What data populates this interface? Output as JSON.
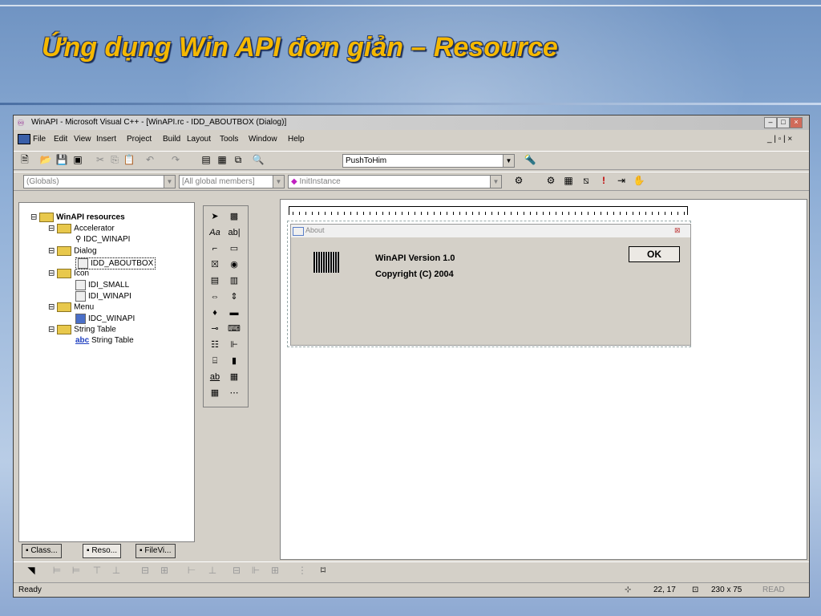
{
  "slide": {
    "title": "Ứng dụng Win API đơn giản – Resource"
  },
  "window": {
    "title": "WinAPI - Microsoft Visual C++ - [WinAPI.rc - IDD_ABOUTBOX (Dialog)]",
    "menu": [
      "File",
      "Edit",
      "View",
      "Insert",
      "Project",
      "Build",
      "Layout",
      "Tools",
      "Window",
      "Help"
    ],
    "toolbar": {
      "find_combo": "PushToHim"
    },
    "wizardbar": {
      "class_combo": "(Globals)",
      "filter_combo": "[All global members]",
      "member_combo": "InitInstance"
    }
  },
  "workspace": {
    "root": "WinAPI resources",
    "nodes": [
      {
        "label": "Accelerator"
      },
      {
        "label": "IDC_WINAPI"
      },
      {
        "label": "Dialog"
      },
      {
        "label": "IDD_ABOUTBOX"
      },
      {
        "label": "Icon"
      },
      {
        "label": "IDI_SMALL"
      },
      {
        "label": "IDI_WINAPI"
      },
      {
        "label": "Menu"
      },
      {
        "label": "IDC_WINAPI"
      },
      {
        "label": "String Table"
      },
      {
        "label": "String Table"
      }
    ],
    "tabs": [
      "Class...",
      "Reso...",
      "FileVi..."
    ]
  },
  "editor": {
    "dialog_title": "About",
    "version_text": "WinAPI Version 1.0",
    "copyright_text": "Copyright (C) 2004",
    "ok_label": "OK"
  },
  "status": {
    "ready": "Ready",
    "position": "22, 17",
    "size": "230 x 75",
    "read": "READ"
  }
}
